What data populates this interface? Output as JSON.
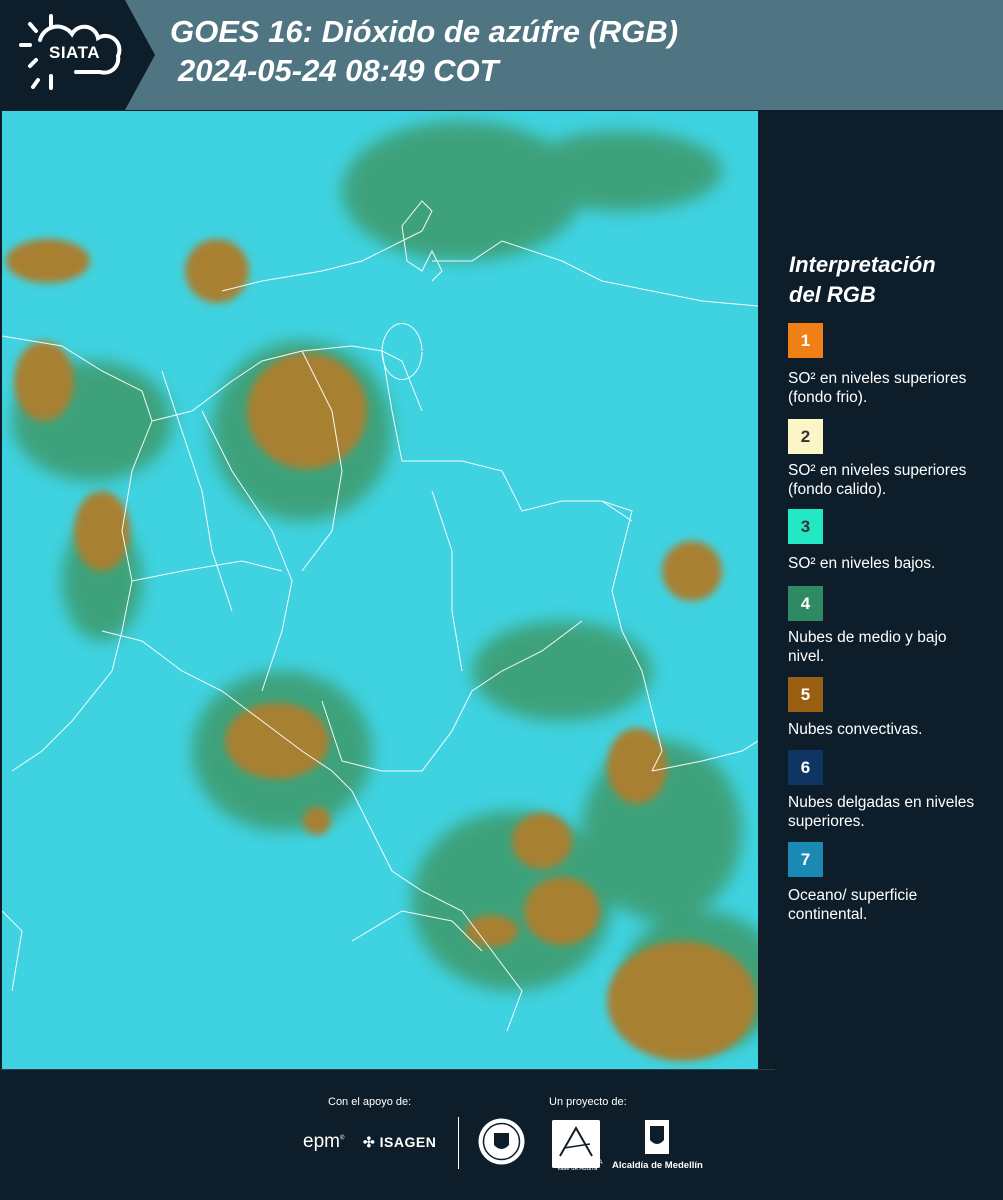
{
  "header": {
    "logo_text": "SIATA",
    "title_line1": "GOES 16: Dióxido de azúfre (RGB)",
    "title_line2": "2024-05-24 08:49 COT"
  },
  "legend": {
    "title_line1": "Interpretación",
    "title_line2": "del RGB",
    "items": [
      {
        "number": "1",
        "color": "#f07f15",
        "label": "SO² en niveles superiores (fondo frio)."
      },
      {
        "number": "2",
        "color": "#fbf5c8",
        "label": "SO² en niveles superiores (fondo calido)."
      },
      {
        "number": "3",
        "color": "#22e8c4",
        "label": "SO² en niveles bajos."
      },
      {
        "number": "4",
        "color": "#2f8a64",
        "label": "Nubes de medio y bajo nivel."
      },
      {
        "number": "5",
        "color": "#9a6012",
        "label": "Nubes convectivas."
      },
      {
        "number": "6",
        "color": "#0f3563",
        "label": "Nubes delgadas en niveles superiores."
      },
      {
        "number": "7",
        "color": "#1a8ab5",
        "label": "Oceano/ superficie continental."
      }
    ]
  },
  "footer": {
    "support_label": "Con el apoyo de:",
    "project_label": "Un proyecto de:",
    "epm_text": "epm",
    "isagen_text": "ISAGEN",
    "area_text": "METROPOLITANA Valle de Aburrá",
    "alcaldia_text": "Alcaldía de Medellín"
  },
  "colors": {
    "background": "#0d1e2a",
    "header": "#4f7583",
    "map_base": "#3fd2e0",
    "cloud_green": "#3c9a6a",
    "cloud_brown": "#a88030",
    "border_lines": "#ffffff"
  }
}
